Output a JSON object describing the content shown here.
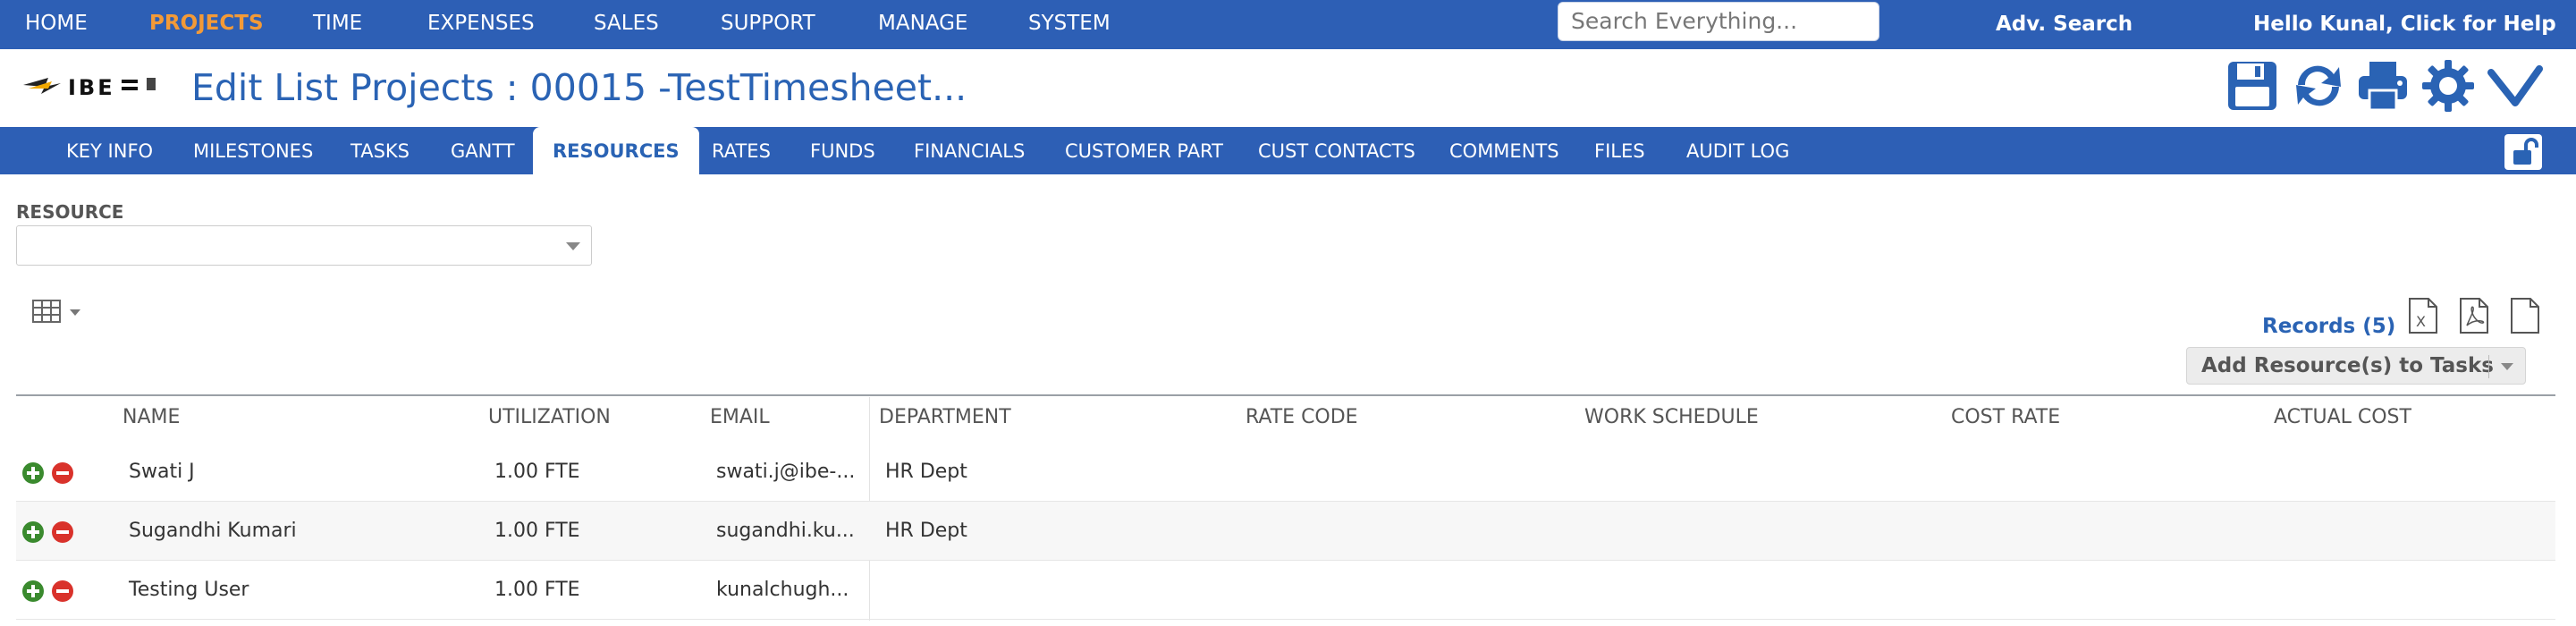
{
  "topnav": {
    "items": [
      "HOME",
      "PROJECTS",
      "TIME",
      "EXPENSES",
      "SALES",
      "SUPPORT",
      "MANAGE",
      "SYSTEM"
    ],
    "active": "PROJECTS",
    "search_placeholder": "Search Everything...",
    "adv_search": "Adv. Search",
    "hello": "Hello Kunal, Click for Help"
  },
  "header": {
    "title": "Edit List Projects : 00015 -TestTimesheet...",
    "icons": [
      "save-icon",
      "refresh-icon",
      "print-icon",
      "settings-icon",
      "check-icon"
    ]
  },
  "tabs": [
    "KEY INFO",
    "MILESTONES",
    "TASKS",
    "GANTT",
    "RESOURCES",
    "RATES",
    "FUNDS",
    "FINANCIALS",
    "CUSTOMER PART",
    "CUST CONTACTS",
    "COMMENTS",
    "FILES",
    "AUDIT LOG"
  ],
  "active_tab": "RESOURCES",
  "filter": {
    "label": "RESOURCE",
    "value": ""
  },
  "records_label": "Records (5)",
  "add_button_label": "Add Resource(s) to Tasks",
  "table": {
    "columns": [
      "NAME",
      "UTILIZATION",
      "EMAIL",
      "DEPARTMENT",
      "RATE CODE",
      "WORK SCHEDULE",
      "COST RATE",
      "ACTUAL COST"
    ],
    "rows": [
      {
        "name": "Swati J",
        "utilization": "1.00 FTE",
        "email": "swati.j@ibe-...",
        "department": "HR Dept",
        "rate_code": "",
        "work_schedule": "",
        "cost_rate": "",
        "actual_cost": ""
      },
      {
        "name": "Sugandhi Kumari",
        "utilization": "1.00 FTE",
        "email": "sugandhi.ku...",
        "department": "HR Dept",
        "rate_code": "",
        "work_schedule": "",
        "cost_rate": "",
        "actual_cost": ""
      },
      {
        "name": "Testing User",
        "utilization": "1.00 FTE",
        "email": "kunalchugh...",
        "department": "",
        "rate_code": "",
        "work_schedule": "",
        "cost_rate": "",
        "actual_cost": ""
      }
    ]
  },
  "colors": {
    "nav_blue": "#2d5fb5",
    "active_orange": "#f39a37",
    "title_blue": "#2a63b4",
    "add_green": "#3a8a2e",
    "remove_red": "#d9322b"
  }
}
